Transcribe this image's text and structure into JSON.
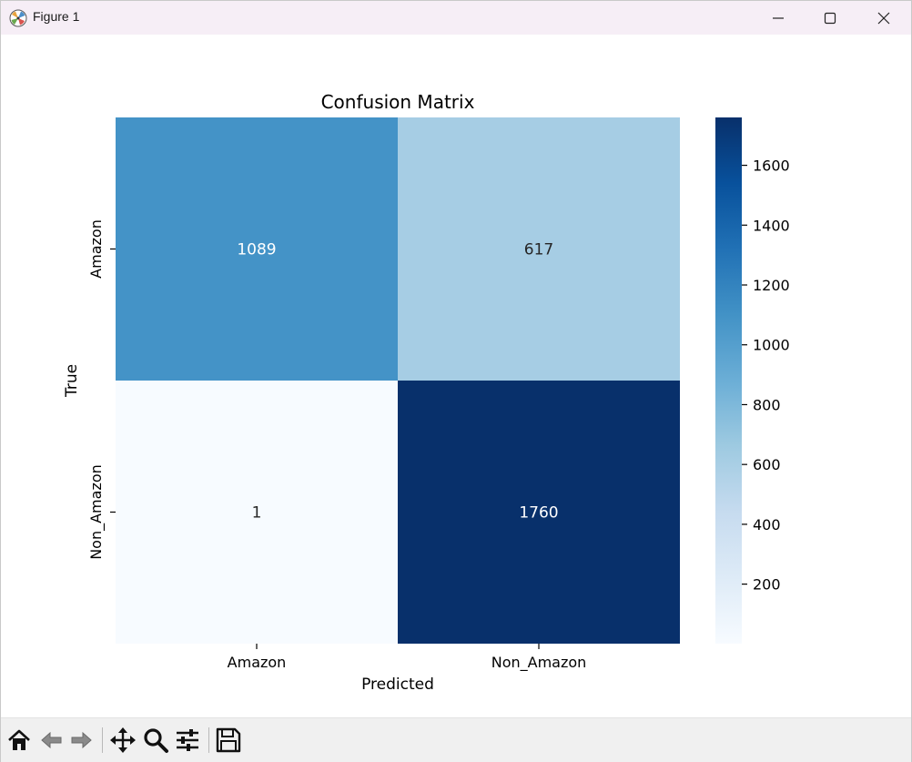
{
  "window": {
    "title": "Figure 1"
  },
  "toolbar": {
    "buttons": [
      {
        "name": "home-icon"
      },
      {
        "name": "back-icon"
      },
      {
        "name": "forward-icon"
      },
      {
        "name": "pan-icon"
      },
      {
        "name": "zoom-icon"
      },
      {
        "name": "configure-subplots-icon"
      },
      {
        "name": "save-icon"
      }
    ]
  },
  "chart_data": {
    "type": "heatmap",
    "title": "Confusion Matrix",
    "xlabel": "Predicted",
    "ylabel": "True",
    "x_categories": [
      "Amazon",
      "Non_Amazon"
    ],
    "y_categories": [
      "Amazon",
      "Non_Amazon"
    ],
    "values": [
      [
        1089,
        617
      ],
      [
        1,
        1760
      ]
    ],
    "colormap": "Blues",
    "colorbar": {
      "range": [
        1,
        1760
      ],
      "ticks": [
        200,
        400,
        600,
        800,
        1000,
        1200,
        1400,
        1600
      ]
    },
    "colors": {
      "min": "#f7fbff",
      "max": "#08306b"
    }
  }
}
